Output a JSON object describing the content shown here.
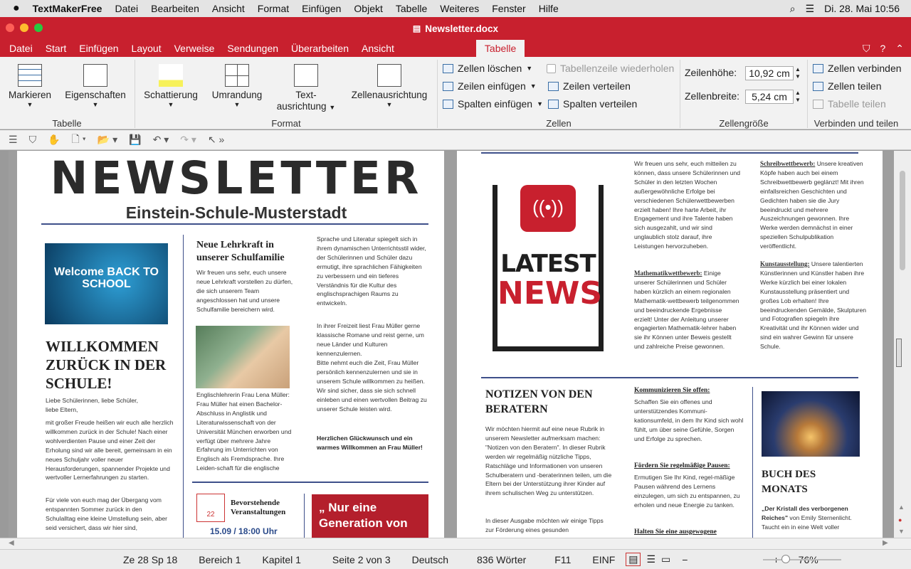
{
  "mac": {
    "app": "TextMakerFree",
    "menus": [
      "Datei",
      "Bearbeiten",
      "Ansicht",
      "Format",
      "Einfügen",
      "Objekt",
      "Tabelle",
      "Weiteres",
      "Fenster",
      "Hilfe"
    ],
    "datetime": "Di. 28. Mai  10:56"
  },
  "window": {
    "title": "Newsletter.docx"
  },
  "tabs": [
    "Datei",
    "Start",
    "Einfügen",
    "Layout",
    "Verweise",
    "Sendungen",
    "Überarbeiten",
    "Ansicht"
  ],
  "active_tab": "Tabelle",
  "ribbon": {
    "markieren": "Markieren",
    "eigenschaften": "Eigenschaften",
    "g_tabelle": "Tabelle",
    "schattierung": "Schattierung",
    "umrandung": "Umrandung",
    "textausrichtung_1": "Text-",
    "textausrichtung_2": "ausrichtung",
    "zellenausrichtung": "Zellenausrichtung",
    "g_format": "Format",
    "zellen_loeschen": "Zellen löschen",
    "zeilen_einfuegen": "Zeilen einfügen",
    "spalten_einfuegen": "Spalten einfügen",
    "tabellenzeile": "Tabellenzeile wiederholen",
    "zeilen_verteilen": "Zeilen verteilen",
    "spalten_verteilen": "Spalten verteilen",
    "g_zellen": "Zellen",
    "zellenhoehe_label": "Zeilenhöhe:",
    "zellenhoehe_val": "10,92 cm",
    "zellenbreite_label": "Zellenbreite:",
    "zellenbreite_val": "5,24 cm",
    "g_groesse": "Zellengröße",
    "zellen_verbinden": "Zellen verbinden",
    "zellen_teilen": "Zellen teilen",
    "tabelle_teilen": "Tabelle teilen",
    "g_verbinden": "Verbinden und teilen"
  },
  "page1": {
    "title": "NEWSLETTER",
    "subtitle": "Einstein-Schule-Musterstadt",
    "img1": "Welcome BACK TO SCHOOL",
    "welcome_title": "WILLKOMMEN ZURÜCK IN DER SCHULE!",
    "welcome_greet": "Liebe Schülerinnen, liebe Schüler, liebe Eltern,",
    "welcome_p1": "mit großer Freude heißen wir euch alle herzlich willkommen zurück in der Schule! Nach einer wohlverdienten Pause und einer Zeit der Erholung sind wir alle bereit, gemeinsam in ein neues Schuljahr voller neuer Herausforderungen, spannender Projekte und wertvoller Lernerfahrungen zu starten.",
    "welcome_p2": "Für viele von euch mag der Übergang vom entspannten Sommer zurück in den Schulalltag eine kleine Umstellung sein, aber seid versichert, dass wir hier sind,",
    "teacher_title": "Neue Lehrkraft in unserer Schulfamilie",
    "teacher_p1": "Wir freuen uns sehr, euch unsere neue Lehrkraft vorstellen zu dürfen, die sich unserem Team angeschlossen hat und unsere Schulfamilie bereichern wird.",
    "teacher_p2": "Englischlehrerin Frau Lena Müller: Frau Müller hat einen Bachelor-Abschluss in Anglistik und Literaturwissenschaft von der Universität München erworben und verfügt über mehrere Jahre Erfahrung im Unterrichten von Englisch als Fremdsprache. Ihre Leiden-schaft für die englische",
    "col3_p1": "Sprache und Literatur spiegelt sich in ihrem dynamischen Unterrichtsstil wider, der Schülerinnen und Schüler dazu ermutigt, ihre sprachlichen Fähigkeiten zu verbessern und ein tieferes Verständnis für die Kultur des englischsprachigen Raums zu entwickeln.",
    "col3_p2": "In ihrer Freizeit liest Frau Müller gerne klassische Romane und reist gerne, um neue Länder und Kulturen kennenzulernen.",
    "col3_p3": "Bitte nehmt euch die Zeit, Frau Müller persönlich kennenzulernen und sie in unserem Schule willkommen zu heißen. Wir sind sicher, dass sie sich schnell einleben und einen wertvollen Beitrag zu unserer Schule leisten wird.",
    "col3_bold": "Herzlichen Glückwunsch und ein warmes Willkommen an Frau Müller!",
    "events_title": "Bevorstehende Veranstaltungen",
    "events_date": "15.09 / 18:00 Uhr",
    "cal_num": "22",
    "quote": "„ Nur eine Generation von"
  },
  "page2": {
    "news_1": "LATEST",
    "news_2": "NEWS",
    "c2_p1": "Wir freuen uns sehr, euch mitteilen zu können, dass unsere Schülerinnen und Schüler in den letzten Wochen außergewöhnliche Erfolge bei verschiedenen Schülerwettbewerben erzielt haben! Ihre harte Arbeit, ihr Engagement und ihre Talente haben sich ausgezahlt, und wir sind unglaublich stolz darauf, ihre Leistungen hervorzuheben.",
    "c2_h2": "Mathematikwettbewerb:",
    "c2_p2": " Einige unserer Schülerinnen und Schüler haben kürzlich an einem regionalen Mathematik-wettbewerb teilgenommen und beeindruckende Ergebnisse erzielt! Unter der Anleitung unserer engagierten Mathematik-lehrer haben sie ihr Können unter Beweis gestellt und zahlreiche Preise gewonnen.",
    "c3_h1": "Schreibwettbewerb:",
    "c3_p1": " Unsere kreativen Köpfe haben auch bei einem Schreibwettbewerb geglänzt! Mit ihren einfallsreichen Geschichten und Gedichten haben sie die Jury beeindruckt und mehrere Auszeichnungen gewonnen. Ihre Werke werden demnächst in einer speziellen Schulpublikation veröffentlicht.",
    "c3_h2": "Kunstausstellung:",
    "c3_p2": " Unsere talentierten Künstlerinnen und Künstler haben ihre Werke kürzlich bei einer lokalen Kunstausstellung präsentiert und großes Lob erhalten! Ihre beeindruckenden Gemälde, Skulpturen und Fotografien spiegeln ihre Kreativität und ihr Können wider und sind ein wahrer Gewinn für unsere Schule.",
    "notes_title": "NOTIZEN VON DEN BERATERN",
    "notes_p1": "Wir möchten hiermit auf eine neue Rubrik in unserem Newsletter aufmerksam machen: \"Notizen von den Beratern\". In dieser Rubrik werden wir regelmäßig nützliche Tipps, Ratschläge und Informationen von unseren Schulberatern und -beraterinnen teilen, um die Eltern bei der Unterstützung ihrer Kinder auf ihrem schulischen Weg zu unterstützen.",
    "notes_p2": "In dieser Ausgabe möchten wir einige Tipps zur Förderung eines gesunden",
    "n2_h1": "Kommunizieren Sie offen:",
    "n2_p1": "Schaffen Sie ein offenes und unterstützendes Kommuni-kationsumfeld, in dem Ihr Kind sich wohl fühlt, um über seine Gefühle, Sorgen und Erfolge zu sprechen.",
    "n2_h2": "Fördern Sie regelmäßige Pausen:",
    "n2_p2": "Ermutigen Sie Ihr Kind, regel-mäßige Pausen während des Lernens einzulegen, um sich zu entspannen, zu erholen und neue Energie zu tanken.",
    "n2_h3": "Halten Sie eine ausgewogene",
    "book_title": "BUCH DES MONATS",
    "book_bold": "„Der Kristall des verborgenen Reiches\"",
    "book_rest": " von Emily Sternenlicht. Taucht ein in eine Welt voller"
  },
  "status": {
    "pos": "Ze 28 Sp 18",
    "bereich": "Bereich 1",
    "kapitel": "Kapitel 1",
    "seite": "Seite 2 von 3",
    "sprache": "Deutsch",
    "woerter": "836 Wörter",
    "f11": "F11",
    "einf": "EINF",
    "zoom": "76%"
  },
  "colors": {
    "brand": "#c8202e",
    "rule": "#3e4f8a",
    "news_red": "#c8202e"
  }
}
